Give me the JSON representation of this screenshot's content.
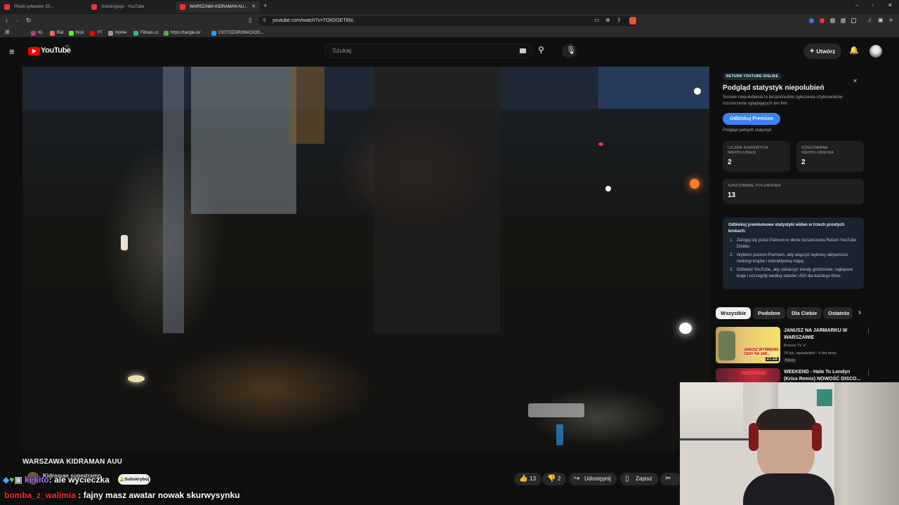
{
  "browser": {
    "tabs": [
      {
        "label": "Plocki sylwester 20...",
        "active": false
      },
      {
        "label": "Subskrypcje - YouTube",
        "active": false
      },
      {
        "label": "WARSZAWA KIDRAMAN AU...",
        "active": true
      }
    ],
    "url": "youtube.com/watch?v=TOhDGETlt5c",
    "bookmarks": [
      {
        "label": "IG",
        "color": "#c13584"
      },
      {
        "label": "Rat",
        "color": "#e66"
      },
      {
        "label": "Kick",
        "color": "#53fc18"
      },
      {
        "label": "YT",
        "color": "#f00"
      },
      {
        "label": "Home",
        "color": "#999"
      },
      {
        "label": "Filman.cc",
        "color": "#3b7"
      },
      {
        "label": "https://tangle.io/",
        "color": "#5a5"
      },
      {
        "label": "CIOTOZORON#CIOO...",
        "color": "#29f"
      }
    ]
  },
  "youtube": {
    "logo_text": "YouTube",
    "logo_region": "PL",
    "search_placeholder": "Szukaj",
    "create_label": "Utwórz"
  },
  "video": {
    "title": "WARSZAWA KIDRAMAN AUU",
    "channel": "Kidraman supertramp",
    "subscribe_label": "Subskrybuj",
    "likes": "13",
    "dislikes": "2",
    "share_label": "Udostępnij",
    "save_label": "Zapisz"
  },
  "dislike_panel": {
    "badge": "RETURN YOUTUBE DISLIKE",
    "heading": "Podgląd statystyk niepolubień",
    "description": "Surowe niepolubienia to bezpośrednie zgłoszenia użytkowników rozszerzenia oglądających ten film.",
    "unlock_button": "Odblokuj Premium",
    "preview_link": "Podgląd pełnych statystyk",
    "raw_dislikes_label": "LICZBA SUROWYCH NIEPOLUBIEŃ",
    "raw_dislikes_value": "2",
    "est_dislikes_label": "SZACOWANE NIEPOLUBIENIA",
    "est_dislikes_value": "2",
    "est_likes_label": "SZACOWANE POLUBIENIA",
    "est_likes_value": "13",
    "steps_heading": "Odblokuj premiumowe statystyki wideo w trzech prostych krokach:",
    "steps": [
      "Zaloguj się przez Patreon w oknie rozszerzenia Return YouTube Dislike.",
      "Wybierz poziom Premium, aby włączyć wykresy aktywności, rankingi krajów i interaktywną mapę.",
      "Odśwież YouTube, aby zobaczyć trendy godzinowe, najlepsze kraje i szczegóły według stanów USA dla każdego filmu."
    ]
  },
  "chips": [
    "Wszystkie",
    "Podobne",
    "Dla Ciebie",
    "Ostatnio"
  ],
  "recommendations": [
    {
      "title": "JANUSZ NA JARMARKU W WARSZAWIE",
      "channel": "Brzoza TV",
      "meta": "70 tys. wyświetleń · 4 dni temu",
      "badge": "Nowy",
      "duration": "27:22",
      "thumb_text": "JANUSZ WYŚMIEWA CENY NA JAR..."
    },
    {
      "title": "WEEKEND - Halo Tu Londyn (Kriss Remix) NOWOŚĆ DISCO...",
      "thumb_text": "WEEKEND"
    }
  ],
  "chat": [
    {
      "user": "kekito",
      "user_color": "#a970ff",
      "message": ": ale wycieczka"
    },
    {
      "user": "bomba_z_walimia",
      "user_color": "#ff2d2d",
      "message": " : fajny masz awatar nowak skurwysynku"
    }
  ]
}
